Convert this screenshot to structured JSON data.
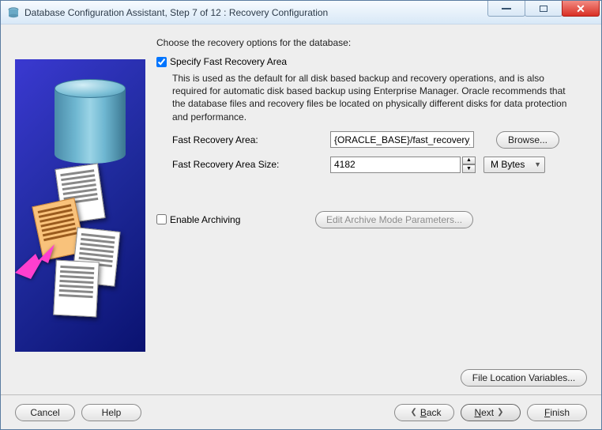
{
  "window": {
    "title": "Database Configuration Assistant, Step 7 of 12 : Recovery Configuration"
  },
  "intro": "Choose the recovery options for the database:",
  "specify": {
    "checked": true,
    "label": "Specify Fast Recovery Area",
    "description": "This is used as the default for all disk based backup and recovery operations, and is also required for automatic disk based backup using Enterprise Manager. Oracle recommends that the database files and recovery files be located on physically different disks for data protection and performance."
  },
  "fields": {
    "fra_label": "Fast Recovery Area:",
    "fra_value": "{ORACLE_BASE}/fast_recovery_area",
    "browse": "Browse...",
    "fra_size_label": "Fast Recovery Area Size:",
    "fra_size_value": "4182",
    "fra_size_unit": "M Bytes"
  },
  "archiving": {
    "checked": false,
    "label": "Enable Archiving",
    "edit_button": "Edit Archive Mode Parameters..."
  },
  "file_loc_button": "File Location Variables...",
  "footer": {
    "cancel": "Cancel",
    "help": "Help",
    "back": "Back",
    "next": "Next",
    "finish": "Finish"
  }
}
